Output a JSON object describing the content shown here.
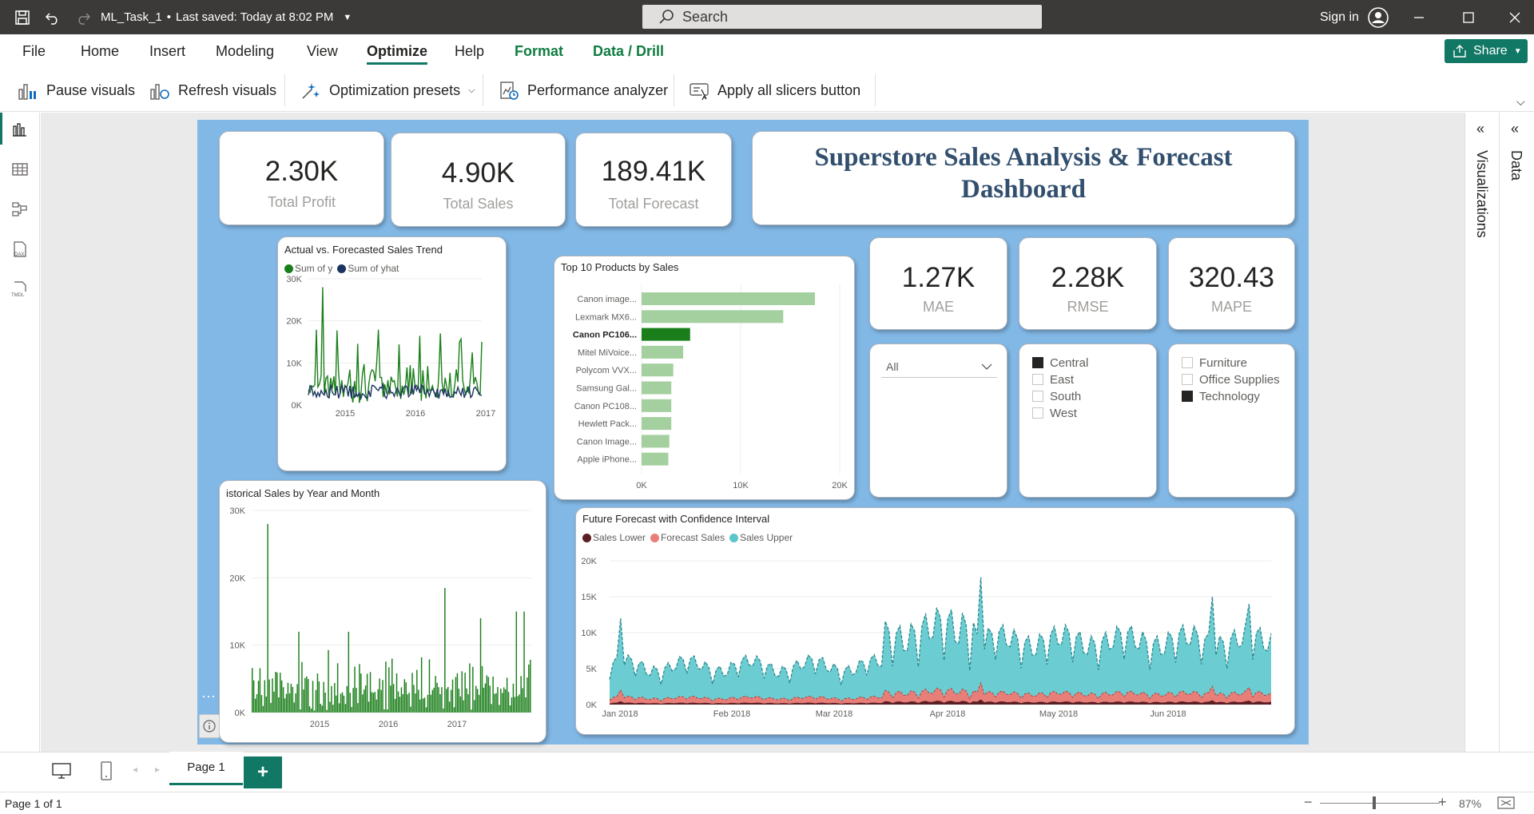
{
  "titlebar": {
    "file_title": "ML_Task_1",
    "saved_status": "Last saved: Today at 8:02 PM",
    "search_placeholder": "Search",
    "sign_in": "Sign in"
  },
  "menu": {
    "items": [
      "File",
      "Home",
      "Insert",
      "Modeling",
      "View",
      "Optimize",
      "Help"
    ],
    "context_items": [
      "Format",
      "Data / Drill"
    ],
    "active": "Optimize",
    "share": "Share"
  },
  "ribbon": {
    "pause": "Pause visuals",
    "refresh": "Refresh visuals",
    "presets": "Optimization presets",
    "perf": "Performance analyzer",
    "apply": "Apply all slicers button"
  },
  "panes": {
    "visualizations": "Visualizations",
    "data": "Data"
  },
  "tabs": {
    "page": "Page 1",
    "add": "+"
  },
  "status": {
    "page_info": "Page 1 of 1",
    "zoom": "87%"
  },
  "colors": {
    "canvas_bg": "#82b8e6",
    "green": "#1a7f1a",
    "navy": "#1c3461",
    "teal": "#5bc6cc",
    "salmon": "#e87e78",
    "darkred": "#5a1f24"
  },
  "kpis": [
    {
      "value": "2.30K",
      "label": "Total Profit"
    },
    {
      "value": "4.90K",
      "label": "Total Sales"
    },
    {
      "value": "189.41K",
      "label": "Total Forecast"
    },
    {
      "value": "1.27K",
      "label": "MAE"
    },
    {
      "value": "2.28K",
      "label": "RMSE"
    },
    {
      "value": "320.43",
      "label": "MAPE"
    }
  ],
  "dashboard_title": "Superstore Sales Analysis & Forecast Dashboard",
  "slicers": {
    "dropdown": "All",
    "regions": [
      {
        "label": "Central",
        "checked": true
      },
      {
        "label": "East",
        "checked": false
      },
      {
        "label": "South",
        "checked": false
      },
      {
        "label": "West",
        "checked": false
      }
    ],
    "categories": [
      {
        "label": "Furniture",
        "checked": false
      },
      {
        "label": "Office Supplies",
        "checked": false
      },
      {
        "label": "Technology",
        "checked": true
      }
    ]
  },
  "chart_data": [
    {
      "type": "line",
      "title": "Actual vs. Forecasted Sales Trend",
      "series": [
        {
          "name": "Sum of y",
          "color": "#1a7f1a"
        },
        {
          "name": "Sum of yhat",
          "color": "#1c3461"
        }
      ],
      "x_ticks": [
        "2015",
        "2016",
        "2017"
      ],
      "y_ticks": [
        "0K",
        "10K",
        "20K",
        "30K"
      ],
      "ylim": [
        0,
        30000
      ],
      "peak": 28000
    },
    {
      "type": "bar",
      "title": "Top 10 Products by Sales",
      "categories": [
        "Canon image...",
        "Lexmark MX6...",
        "Canon PC106...",
        "Mitel MiVoice...",
        "Polycom VVX...",
        "Samsung Gal...",
        "Canon PC108...",
        "Hewlett Pack...",
        "Canon Image...",
        "Apple iPhone..."
      ],
      "values": [
        17500,
        14300,
        4900,
        4200,
        3200,
        3000,
        3000,
        3000,
        2800,
        2700
      ],
      "highlight": "Canon PC106...",
      "x_ticks": [
        "0K",
        "10K",
        "20K"
      ],
      "xlim": [
        0,
        20000
      ]
    },
    {
      "type": "bar",
      "title": "istorical Sales by Year and Month",
      "x_ticks": [
        "2015",
        "2016",
        "2017"
      ],
      "y_ticks": [
        "0K",
        "10K",
        "20K",
        "30K"
      ],
      "ylim": [
        0,
        30000
      ],
      "peak": 28000
    },
    {
      "type": "area",
      "title": "Future Forecast with Confidence Interval",
      "series": [
        {
          "name": "Sales Lower",
          "color": "#5a1f24"
        },
        {
          "name": "Forecast Sales",
          "color": "#e87e78"
        },
        {
          "name": "Sales Upper",
          "color": "#5bc6cc"
        }
      ],
      "x_ticks": [
        "Jan 2018",
        "Feb 2018",
        "Mar 2018",
        "Apr 2018",
        "May 2018",
        "Jun 2018"
      ],
      "y_ticks": [
        "0K",
        "5K",
        "10K",
        "15K",
        "20K"
      ],
      "ylim": [
        0,
        20000
      ],
      "peak": 17700
    }
  ]
}
